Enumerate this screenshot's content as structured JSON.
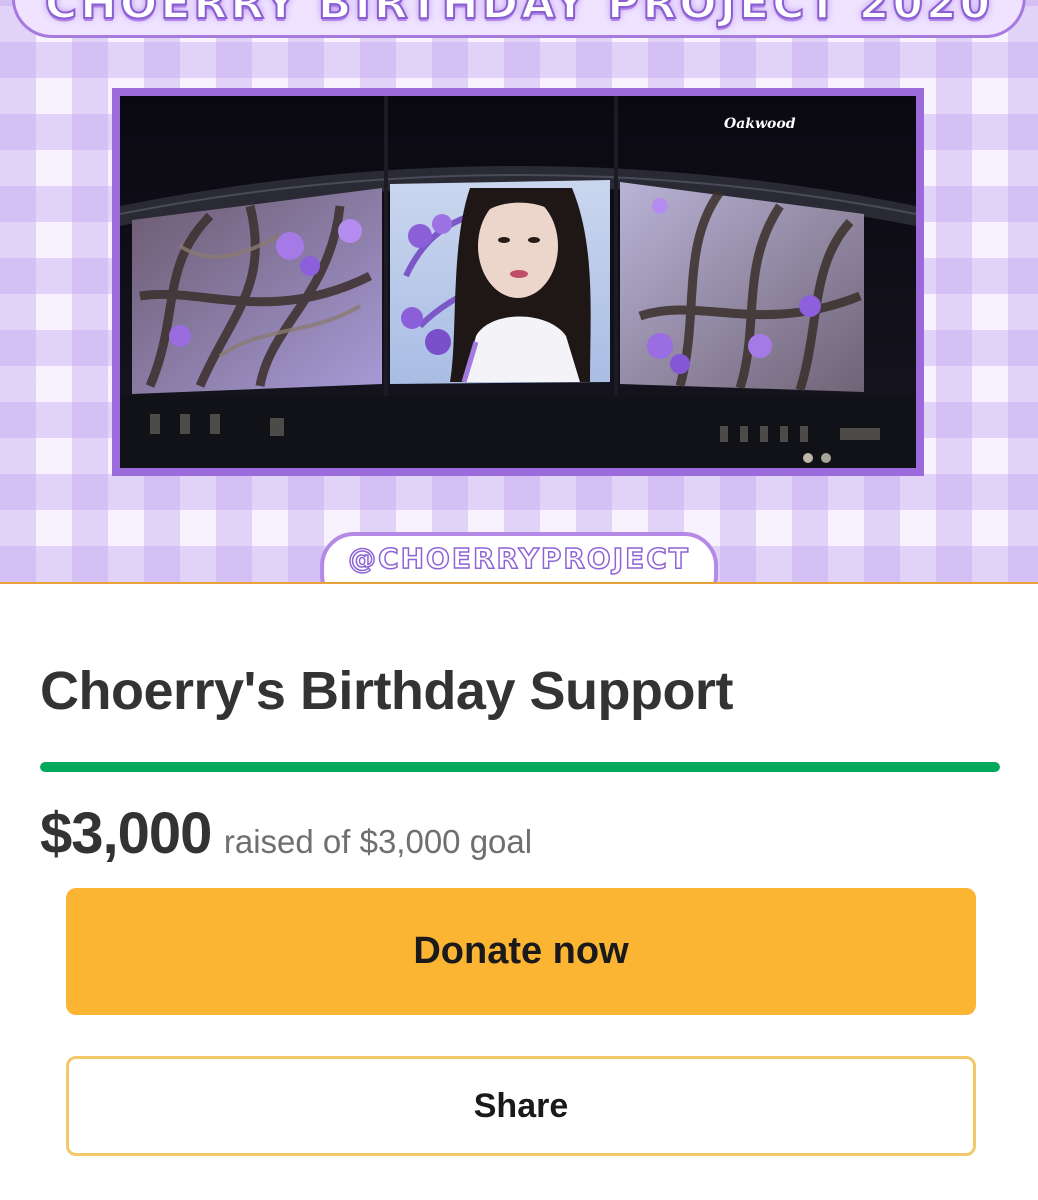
{
  "hero": {
    "banner_title": "CHOERRY BIRTHDAY PROJECT 2020",
    "building_sign": "Oakwood",
    "handle": "@CHOERRYPROJECT",
    "colors": {
      "frame": "#9b6bdc",
      "gingham": "#bea0f0"
    }
  },
  "campaign": {
    "title": "Choerry's Birthday Support",
    "raised": "$3,000",
    "goal_text": "raised of $3,000 goal",
    "progress_fraction": 1.0,
    "progress_color": "#02a95c"
  },
  "actions": {
    "donate_label": "Donate now",
    "donate_color": "#fbb532",
    "share_label": "Share"
  }
}
